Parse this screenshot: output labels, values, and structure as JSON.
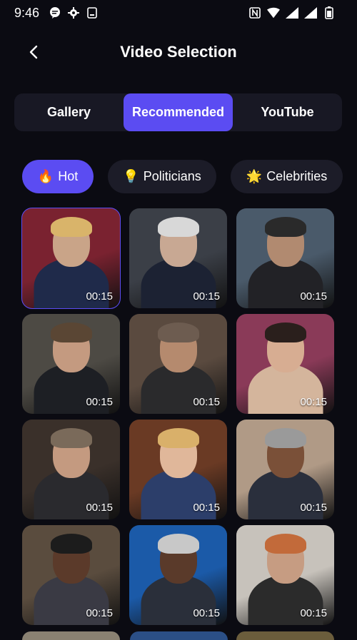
{
  "status_bar": {
    "time": "9:46",
    "left_icons": [
      "message-bubble-icon",
      "settings-gear-icon",
      "phone-storage-icon"
    ],
    "right_icons": [
      "nfc-icon",
      "wifi-icon",
      "cell-signal-icon",
      "battery-icon"
    ]
  },
  "header": {
    "title": "Video Selection",
    "back_icon": "back-arrow-icon"
  },
  "tabs": [
    {
      "label": "Gallery",
      "active": false
    },
    {
      "label": "Recommended",
      "active": true
    },
    {
      "label": "YouTube",
      "active": false
    }
  ],
  "chips": [
    {
      "emoji": "🔥",
      "label": "Hot",
      "active": true
    },
    {
      "emoji": "💡",
      "label": "Politicians",
      "active": false
    },
    {
      "emoji": "🌟",
      "label": "Celebrities",
      "active": false
    }
  ],
  "videos": [
    {
      "duration": "00:15",
      "selected": true
    },
    {
      "duration": "00:15",
      "selected": false
    },
    {
      "duration": "00:15",
      "selected": false
    },
    {
      "duration": "00:15",
      "selected": false
    },
    {
      "duration": "00:15",
      "selected": false
    },
    {
      "duration": "00:15",
      "selected": false
    },
    {
      "duration": "00:15",
      "selected": false
    },
    {
      "duration": "00:15",
      "selected": false
    },
    {
      "duration": "00:15",
      "selected": false
    },
    {
      "duration": "00:15",
      "selected": false
    },
    {
      "duration": "00:15",
      "selected": false
    },
    {
      "duration": "00:15",
      "selected": false
    }
  ],
  "colors": {
    "background": "#0b0b12",
    "accent": "#5b4cf2",
    "surface": "#181824",
    "chip": "#1c1c28"
  }
}
